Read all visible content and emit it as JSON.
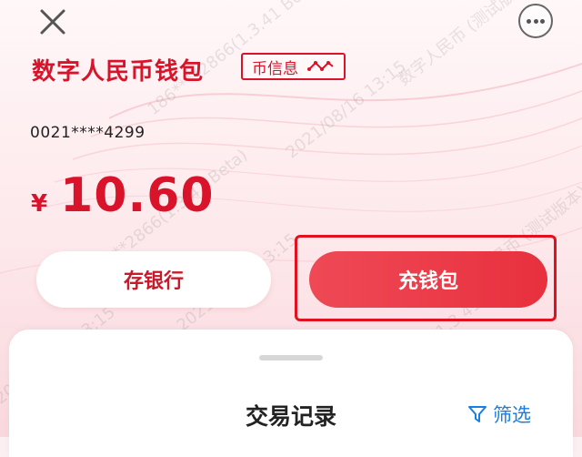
{
  "header": {
    "title": "数字人民币钱包",
    "coin_info_label": "币信息"
  },
  "wallet": {
    "account_number": "0021****4299",
    "currency_symbol": "¥",
    "balance": "10.60"
  },
  "actions": {
    "deposit_bank_label": "存银行",
    "recharge_wallet_label": "充钱包"
  },
  "records": {
    "title": "交易记录",
    "filter_label": "筛选"
  },
  "icons": {
    "close": "close-icon",
    "more": "more-icon",
    "coin_info": "wave-icon",
    "filter": "funnel-icon"
  },
  "colors": {
    "brand_red": "#d8132a",
    "button_gradient_start": "#ef4956",
    "button_gradient_end": "#e8303e",
    "filter_blue": "#1a7de0"
  }
}
